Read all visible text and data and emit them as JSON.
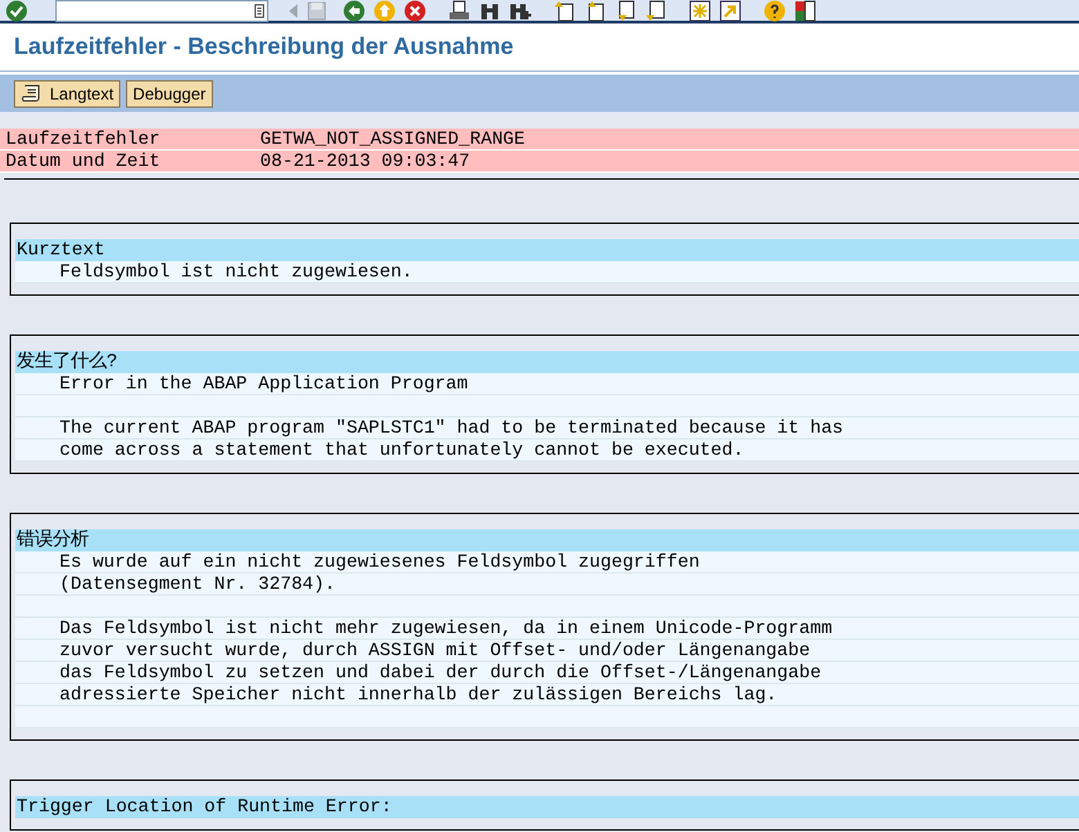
{
  "title": "Laufzeitfehler - Beschreibung der Ausnahme",
  "buttons": [
    {
      "label": "Langtext",
      "kind": "icon"
    },
    {
      "label": "Debugger",
      "kind": "plain"
    }
  ],
  "header_rows": [
    {
      "label": "Laufzeitfehler",
      "value": "GETWA_NOT_ASSIGNED_RANGE"
    },
    {
      "label": "Datum und Zeit",
      "value": "08-21-2013 09:03:47"
    }
  ],
  "sections": [
    {
      "title": "Kurztext",
      "paragraphs": [
        [
          "Feldsymbol ist nicht zugewiesen."
        ]
      ]
    },
    {
      "title": "发生了什么?",
      "paragraphs": [
        [
          "Error in the ABAP Application Program"
        ],
        [
          "The current ABAP program \"SAPLSTC1\" had to be terminated because it has",
          "come across a statement that unfortunately cannot be executed."
        ]
      ]
    },
    {
      "title": "错误分析",
      "paragraphs": [
        [
          "Es wurde auf ein nicht zugewiesenes Feldsymbol zugegriffen",
          "(Datensegment Nr. 32784)."
        ],
        [
          "Das Feldsymbol ist nicht mehr zugewiesen, da in einem Unicode-Programm",
          "zuvor versucht wurde, durch ASSIGN mit Offset- und/oder Längenangabe",
          "das Feldsymbol zu setzen und dabei der durch die Offset-/Längenangabe",
          "adressierte Speicher nicht innerhalb der zulässigen Bereichs lag."
        ]
      ],
      "trailing_blank": true
    },
    {
      "title": "Trigger Location of Runtime Error:"
    }
  ]
}
